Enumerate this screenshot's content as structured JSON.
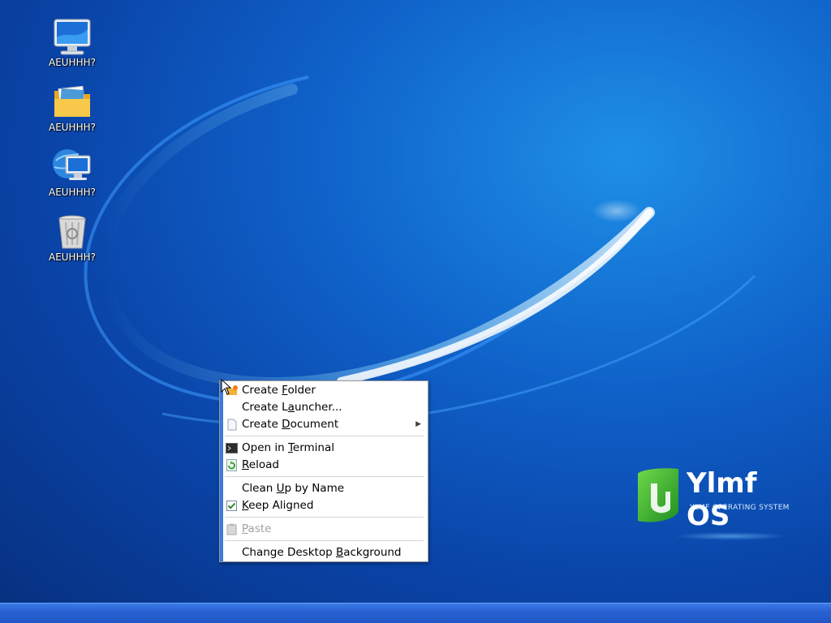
{
  "desktop": {
    "icons": [
      {
        "label": "AEUHHH?",
        "icon": "computer-icon"
      },
      {
        "label": "AEUHHH?",
        "icon": "home-folder-icon"
      },
      {
        "label": "AEUHHH?",
        "icon": "network-icon"
      },
      {
        "label": "AEUHHH?",
        "icon": "trash-icon"
      }
    ]
  },
  "brand": {
    "name": "Ylmf OS",
    "tagline": "YLMF OPERATING SYSTEM"
  },
  "context_menu": {
    "items": [
      {
        "pre": "Create ",
        "key": "F",
        "post": "older",
        "icon": "create-folder-icon"
      },
      {
        "pre": "Create L",
        "key": "a",
        "post": "uncher...",
        "icon": ""
      },
      {
        "pre": "Create ",
        "key": "D",
        "post": "ocument",
        "icon": "document-icon",
        "submenu": true
      },
      {
        "pre": "Open in ",
        "key": "T",
        "post": "erminal",
        "icon": "terminal-icon"
      },
      {
        "pre": "",
        "key": "R",
        "post": "eload",
        "icon": "reload-icon"
      },
      {
        "pre": "Clean ",
        "key": "U",
        "post": "p by Name",
        "icon": ""
      },
      {
        "pre": "",
        "key": "K",
        "post": "eep Aligned",
        "icon": "checkbox-checked-icon",
        "checked": true
      },
      {
        "pre": "",
        "key": "P",
        "post": "aste",
        "icon": "paste-icon",
        "disabled": true
      },
      {
        "pre": "Change Desktop ",
        "key": "B",
        "post": "ackground",
        "icon": ""
      }
    ]
  },
  "colors": {
    "desktop_bg": "#0f62c9",
    "menu_accent": "#3d79d9",
    "taskbar": "#2a63d4"
  }
}
